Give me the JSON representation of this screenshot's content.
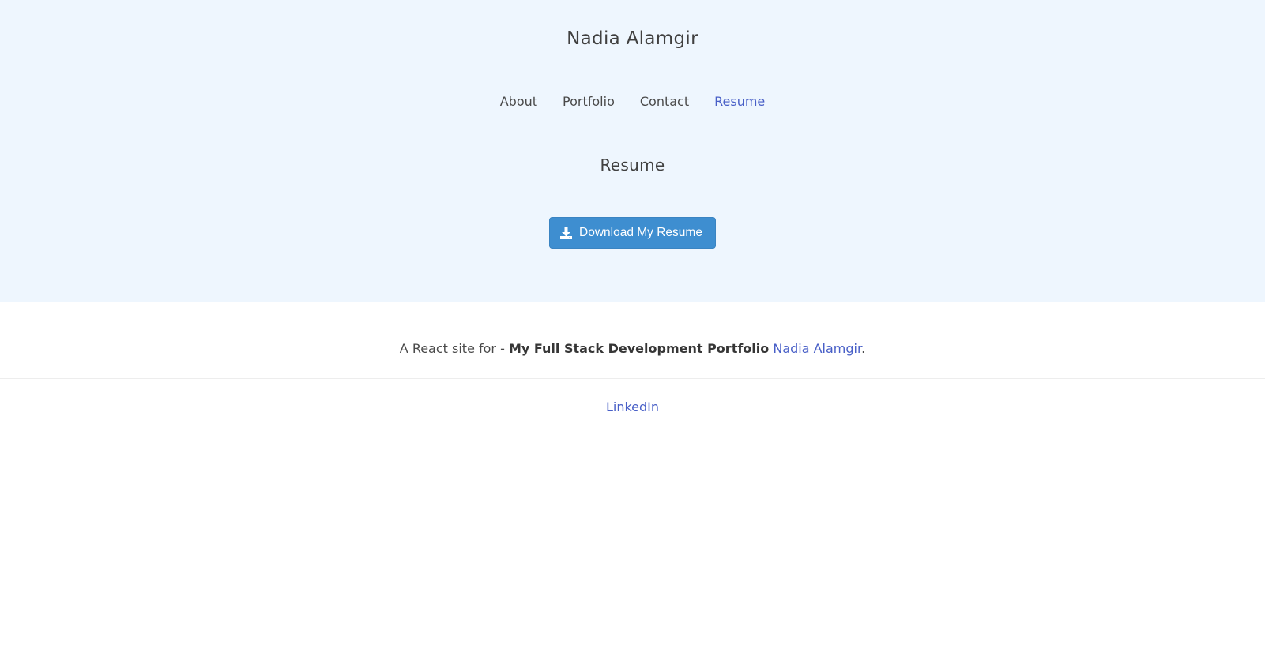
{
  "header": {
    "site_title": "Nadia Alamgir"
  },
  "nav": {
    "tabs": [
      {
        "label": "About",
        "active": false
      },
      {
        "label": "Portfolio",
        "active": false
      },
      {
        "label": "Contact",
        "active": false
      },
      {
        "label": "Resume",
        "active": true
      }
    ]
  },
  "main": {
    "heading": "Resume",
    "download_button": {
      "label": "Download My Resume",
      "icon": "download-icon"
    }
  },
  "footer": {
    "prefix": "A React site for - ",
    "bold_text": "My Full Stack Development Portfolio",
    "author_link": "Nadia Alamgir",
    "suffix": ".",
    "linkedin_label": "LinkedIn"
  },
  "colors": {
    "hero_background": "#eef6fe",
    "accent": "#485fc7",
    "button": "#3e8ed0"
  }
}
